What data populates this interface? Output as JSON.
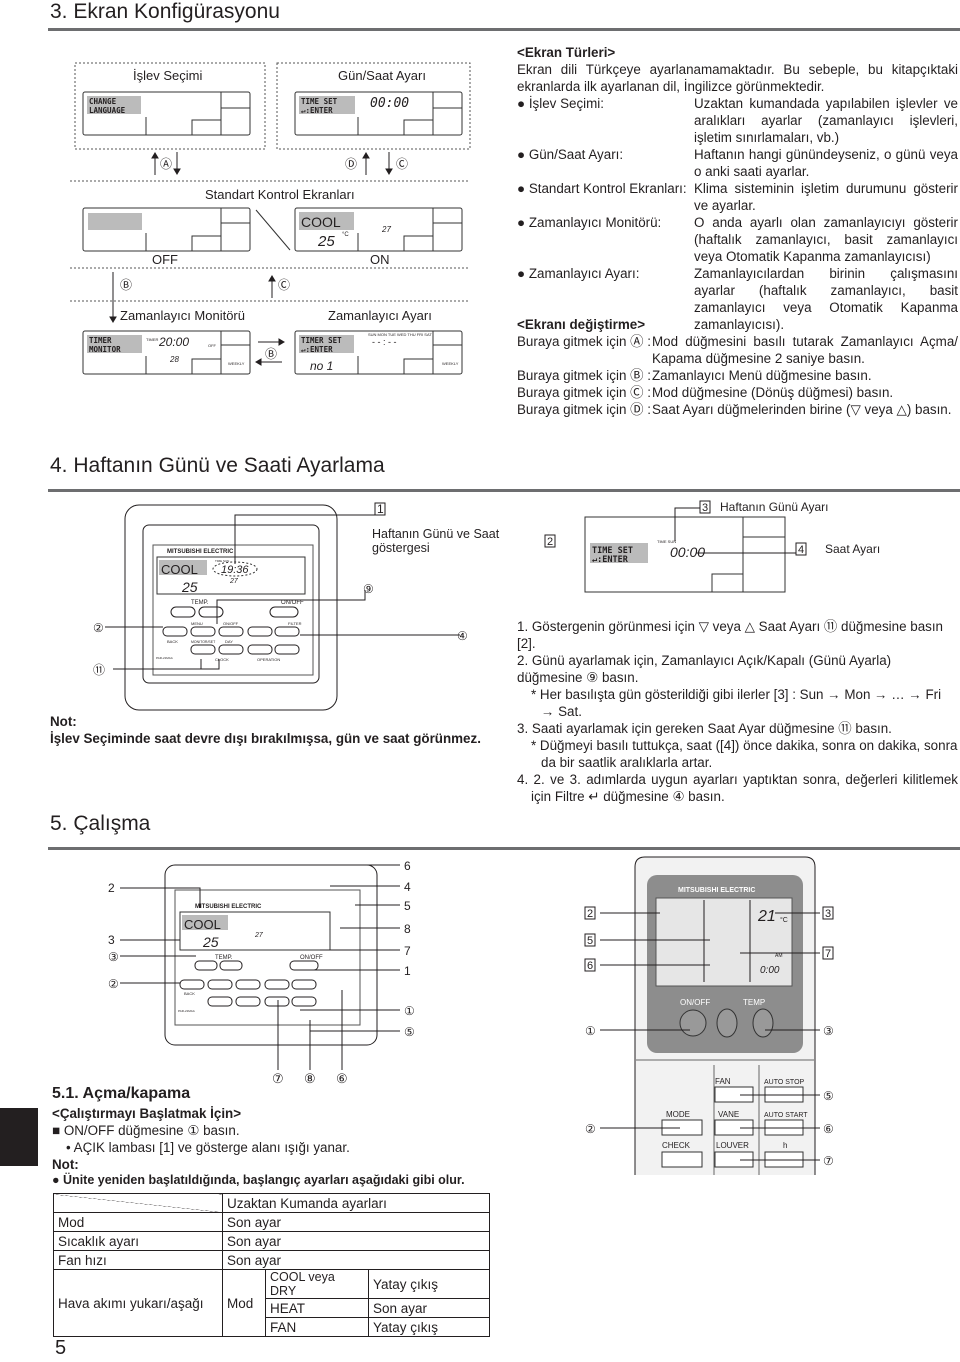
{
  "section3": {
    "title": "3. Ekran Konfigürasyonu"
  },
  "diagram3": {
    "islev": "İşlev Seçimi",
    "gunsaat": "Gün/Saat Ayarı",
    "standart": "Standart Kontrol Ekranları",
    "off": "OFF",
    "on": "ON",
    "monitor": "Zamanlayıcı Monitörü",
    "ayari": "Zamanlayıcı Ayarı",
    "change1": "CHANGE",
    "change2": "LANGUAGE",
    "timeset1": "TIME SET",
    "timeset2": "↵:ENTER",
    "time": "00:00",
    "cool": "COOL",
    "temp": "25",
    "unit": "°C",
    "room": "27",
    "timer1": "TIMER",
    "timer2": "MONITOR",
    "timerlbl": "TIMER",
    "ttime": "20:00",
    "mon": "MON",
    "ttemp": "28",
    "offlbl": "OFF",
    "weekly": "WEEKLY",
    "tset1": "TIMER SET",
    "tset2": "↵:ENTER",
    "days": "SUN MON TUE WED THU FRI SAT",
    "dashes": "- - : - -",
    "no": "no 1",
    "A": "Ⓐ",
    "B": "Ⓑ",
    "C": "Ⓒ",
    "D": "Ⓓ"
  },
  "screens": {
    "heading": "<Ekran Türleri>",
    "intro": "Ekran dili Türkçeye ayarlanamamaktadır. Bu sebeple, bu kitapçıktaki ekranlarda ilk ayarlanan dil, İngilizce görünmektedir.",
    "items": [
      {
        "label": "İşlev Seçimi:",
        "text": "Uzaktan kumandada yapılabilen işlevler ve aralıkları ayarlar (zamanlayıcı işlevleri, işletim sınırlamaları, vb.)"
      },
      {
        "label": "Gün/Saat Ayarı:",
        "text": "Haftanın hangi günündeyseniz, o günü veya o anki saati ayarlar."
      },
      {
        "label": "Standart Kontrol Ekranları:",
        "text": "Klima sisteminin işletim durumunu gösterir ve ayarlar."
      },
      {
        "label": "Zamanlayıcı Monitörü:",
        "text": "O anda ayarlı olan zamanlayıcıyı gösterir (haftalık zamanlayıcı, basit zamanlayıcı veya Otomatik Kapanma zamanlayıcısı)"
      },
      {
        "label": "Zamanlayıcı Ayarı:",
        "text": "Zamanlayıcılardan birinin çalışmasını ayarlar (haftalık zamanlayıcı, basit zamanlayıcı veya Otomatik Kapanma zamanlayıcısı)."
      }
    ],
    "change_heading": "<Ekranı değiştirme>",
    "goto": [
      {
        "label": "Buraya gitmek için Ⓐ :",
        "text": "Mod düğmesini basılı tutarak Zamanlayıcı Açma/ Kapama düğmesine 2 saniye basın."
      },
      {
        "label": "Buraya gitmek için Ⓑ :",
        "text": "Zamanlayıcı Menü düğmesine basın."
      },
      {
        "label": "Buraya gitmek için Ⓒ :",
        "text": "Mod düğmesine (Dönüş düğmesi) basın."
      },
      {
        "label": "Buraya gitmek için Ⓓ :",
        "text": "Saat Ayarı düğmelerinden birine (▽ veya △) basın."
      }
    ]
  },
  "section4": {
    "title": "4. Haftanın Günü ve Saati Ayarlama",
    "callout1": "1",
    "callout1_text": "Haftanın Günü ve Saat göstergesi",
    "callout3": "3",
    "callout3_text": "Haftanın Günü Ayarı",
    "callout4": "4",
    "callout4_text": "Saat Ayarı",
    "callout2": "2",
    "c9": "⑨",
    "c4": "④",
    "c2": "②",
    "c11": "⑪",
    "remote": {
      "brand": "MITSUBISHI ELECTRIC",
      "mode": "COOL",
      "time": "19:36",
      "temp": "25",
      "room": "27",
      "temp_label": "TEMP.",
      "onoff": "ON/OFF",
      "menu": "MENU",
      "onoff2": "ON/OFF",
      "filter": "FILTER",
      "back": "BACK",
      "monitor": "MONITOR/SET",
      "day": "DAY",
      "clock": "CLOCK",
      "operation": "OPERATION",
      "check": "CHECK",
      "test": "TEST",
      "clear": "CLEAR",
      "model": "PAR-21MAA",
      "daylbl": "TIME SUN"
    },
    "lcd": {
      "line1": "TIME SET",
      "line2": "↵:ENTER",
      "time": "00:00",
      "daylbl": "TIME SUN"
    },
    "note_label": "Not:",
    "note": "İşlev Seçiminde saat devre dışı bırakılmışsa, gün ve saat görünmez.",
    "steps": [
      "1. Göstergenin görünmesi için ▽ veya △ Saat Ayarı ⑪ düğmesine basın [2].",
      "2. Günü ayarlamak için, Zamanlayıcı Açık/Kapalı (Günü Ayarla) düğmesine ⑨ basın.",
      "* Her basılışta gün gösterildiği gibi ilerler [3] : Sun → Mon → … → Fri → Sat.",
      "3. Saati ayarlamak için gereken Saat Ayar düğmesine ⑪ basın.",
      "* Düğmeyi basılı tuttukça, saat ([4]) önce dakika, sonra on dakika, sonra da bir saatlik aralıklarla artar.",
      "4. 2. ve 3. adımlarda uygun ayarları yaptıktan sonra, değerleri kilitlemek için Filtre ↵ düğmesine ④ basın."
    ]
  },
  "section5": {
    "title": "5. Çalışma",
    "wired_left": [
      "2",
      "3",
      "③",
      "②"
    ],
    "wired_right": [
      "6",
      "4",
      "5",
      "8",
      "7",
      "1",
      "①",
      "⑤"
    ],
    "wired_bottom": [
      "⑦",
      "⑧",
      "⑥"
    ],
    "ir_left": [
      "2",
      "5",
      "6",
      "①",
      "②"
    ],
    "ir_right": [
      "3",
      "7",
      "③",
      "⑤",
      "⑥",
      "⑦"
    ],
    "ir": {
      "brand": "MITSUBISHI ELECTRIC",
      "temp": "21",
      "unit": "°C",
      "am": "AM",
      "time": "0:00",
      "onoff": "ON/OFF",
      "temp_label": "TEMP",
      "fan": "FAN",
      "autostop": "AUTO STOP",
      "mode": "MODE",
      "vane": "VANE",
      "autostart": "AUTO START",
      "check": "CHECK",
      "louver": "LOUVER",
      "h": "h"
    },
    "sub_title": "5.1. Açma/kapama",
    "start_heading": "<Çalıştırmayı Başlatmak İçin>",
    "step1": "ON/OFF düğmesine ① basın.",
    "bullet": "AÇIK lambası [1] ve gösterge alanı ışığı yanar.",
    "note_label": "Not:",
    "note": "Ünite yeniden başlatıldığında, başlangıç ayarları aşağıdaki gibi olur.",
    "table": {
      "header": "Uzaktan Kumanda ayarları",
      "rows": [
        {
          "k": "Mod",
          "v": "Son ayar"
        },
        {
          "k": "Sıcaklık ayarı",
          "v": "Son ayar"
        },
        {
          "k": "Fan hızı",
          "v": "Son ayar"
        }
      ],
      "airflow": "Hava akımı yukarı/aşağı",
      "mod": "Mod",
      "sub": [
        {
          "k": "COOL veya DRY",
          "v": "Yatay çıkış"
        },
        {
          "k": "HEAT",
          "v": "Son ayar"
        },
        {
          "k": "FAN",
          "v": "Yatay çıkış"
        }
      ]
    }
  },
  "page_number": "5"
}
